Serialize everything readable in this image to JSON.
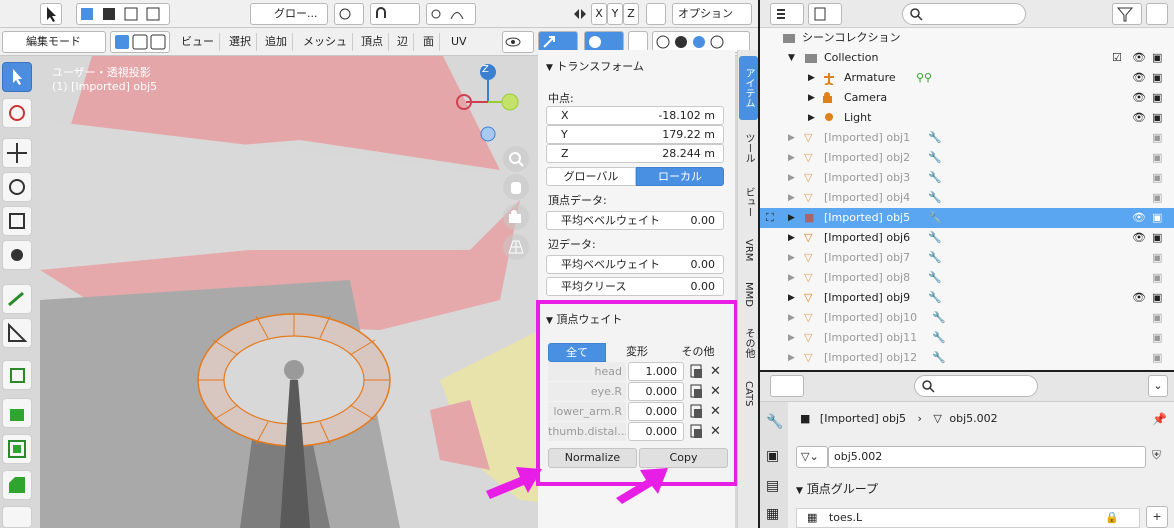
{
  "viewport": {
    "mode_select": "編集モード",
    "orientation_select": "グロー...",
    "menus": [
      "ビュー",
      "選択",
      "追加",
      "メッシュ",
      "頂点",
      "辺",
      "面",
      "UV"
    ],
    "axis_labels": [
      "X",
      "Y",
      "Z"
    ],
    "options_button": "オプション",
    "overlay_title": "ユーザー・透視投影",
    "overlay_object": "(1) [Imported] obj5",
    "gizmo_z": "Z"
  },
  "npanel": {
    "section_transform": "トランスフォーム",
    "median_label": "中点:",
    "fields": [
      {
        "label": "X",
        "value": "-18.102 m"
      },
      {
        "label": "Y",
        "value": "179.22 m"
      },
      {
        "label": "Z",
        "value": "28.244 m"
      }
    ],
    "space_global": "グローバル",
    "space_local": "ローカル",
    "vertex_data_label": "頂点データ:",
    "vertex_bevel_label": "平均ベベルウェイト",
    "vertex_bevel_value": "0.00",
    "edge_data_label": "辺データ:",
    "edge_bevel_label": "平均ベベルウェイト",
    "edge_bevel_value": "0.00",
    "edge_crease_label": "平均クリース",
    "edge_crease_value": "0.00",
    "vw_section": "頂点ウェイト",
    "vw_tabs": [
      "全て",
      "変形",
      "その他"
    ],
    "weights": [
      {
        "name": "head",
        "value": "1.000"
      },
      {
        "name": "eye.R",
        "value": "0.000"
      },
      {
        "name": "lower_arm.R",
        "value": "0.000"
      },
      {
        "name": "thumb.distal...",
        "value": "0.000"
      }
    ],
    "normalize_button": "Normalize",
    "copy_button": "Copy",
    "tabs": [
      "アイテム",
      "ツール",
      "ビュー",
      "VRM",
      "MMD",
      "その他",
      "CATS"
    ]
  },
  "outliner": {
    "search_placeholder": "",
    "scene_collection": "シーンコレクション",
    "collection": "Collection",
    "objects": [
      {
        "name": "Armature"
      },
      {
        "name": "Camera"
      },
      {
        "name": "Light"
      },
      {
        "name": "[Imported] obj1"
      },
      {
        "name": "[Imported] obj2"
      },
      {
        "name": "[Imported] obj3"
      },
      {
        "name": "[Imported] obj4"
      },
      {
        "name": "[Imported] obj5"
      },
      {
        "name": "[Imported] obj6"
      },
      {
        "name": "[Imported] obj7"
      },
      {
        "name": "[Imported] obj8"
      },
      {
        "name": "[Imported] obj9"
      },
      {
        "name": "[Imported] obj10"
      },
      {
        "name": "[Imported] obj11"
      },
      {
        "name": "[Imported] obj12"
      }
    ]
  },
  "properties": {
    "breadcrumb_object": "[Imported] obj5",
    "breadcrumb_mesh": "obj5.002",
    "mesh_name": "obj5.002",
    "vertex_groups_header": "頂点グループ",
    "group_item": "toes.L"
  },
  "colors": {
    "accent": "#4a90e2",
    "highlight": "#e91ee6",
    "selection": "#5aa6f0"
  }
}
